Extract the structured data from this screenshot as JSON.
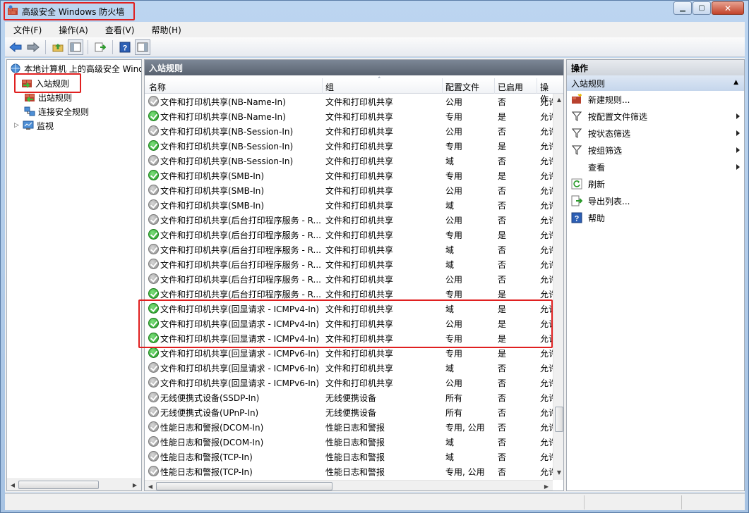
{
  "window": {
    "title": "高级安全 Windows 防火墙",
    "min_label": "▁",
    "max_label": "▢",
    "close_label": "✕"
  },
  "menu": [
    "文件(F)",
    "操作(A)",
    "查看(V)",
    "帮助(H)"
  ],
  "tree": {
    "root": "本地计算机 上的高级安全 Windows 防火墙",
    "items": [
      "入站规则",
      "出站规则",
      "连接安全规则",
      "监视"
    ]
  },
  "list": {
    "title": "入站规则",
    "columns": [
      "名称",
      "组",
      "配置文件",
      "已启用",
      "操作"
    ],
    "rows": [
      {
        "name": "文件和打印机共享(NB-Name-In)",
        "group": "文件和打印机共享",
        "profile": "公用",
        "enabled": "否",
        "action": "允许",
        "on": false
      },
      {
        "name": "文件和打印机共享(NB-Name-In)",
        "group": "文件和打印机共享",
        "profile": "专用",
        "enabled": "是",
        "action": "允许",
        "on": true
      },
      {
        "name": "文件和打印机共享(NB-Session-In)",
        "group": "文件和打印机共享",
        "profile": "公用",
        "enabled": "否",
        "action": "允许",
        "on": false
      },
      {
        "name": "文件和打印机共享(NB-Session-In)",
        "group": "文件和打印机共享",
        "profile": "专用",
        "enabled": "是",
        "action": "允许",
        "on": true
      },
      {
        "name": "文件和打印机共享(NB-Session-In)",
        "group": "文件和打印机共享",
        "profile": "域",
        "enabled": "否",
        "action": "允许",
        "on": false
      },
      {
        "name": "文件和打印机共享(SMB-In)",
        "group": "文件和打印机共享",
        "profile": "专用",
        "enabled": "是",
        "action": "允许",
        "on": true
      },
      {
        "name": "文件和打印机共享(SMB-In)",
        "group": "文件和打印机共享",
        "profile": "公用",
        "enabled": "否",
        "action": "允许",
        "on": false
      },
      {
        "name": "文件和打印机共享(SMB-In)",
        "group": "文件和打印机共享",
        "profile": "域",
        "enabled": "否",
        "action": "允许",
        "on": false
      },
      {
        "name": "文件和打印机共享(后台打印程序服务 - R...",
        "group": "文件和打印机共享",
        "profile": "公用",
        "enabled": "否",
        "action": "允许",
        "on": false
      },
      {
        "name": "文件和打印机共享(后台打印程序服务 - R...",
        "group": "文件和打印机共享",
        "profile": "专用",
        "enabled": "是",
        "action": "允许",
        "on": true
      },
      {
        "name": "文件和打印机共享(后台打印程序服务 - R...",
        "group": "文件和打印机共享",
        "profile": "域",
        "enabled": "否",
        "action": "允许",
        "on": false
      },
      {
        "name": "文件和打印机共享(后台打印程序服务 - R...",
        "group": "文件和打印机共享",
        "profile": "域",
        "enabled": "否",
        "action": "允许",
        "on": false
      },
      {
        "name": "文件和打印机共享(后台打印程序服务 - R...",
        "group": "文件和打印机共享",
        "profile": "公用",
        "enabled": "否",
        "action": "允许",
        "on": false
      },
      {
        "name": "文件和打印机共享(后台打印程序服务 - R...",
        "group": "文件和打印机共享",
        "profile": "专用",
        "enabled": "是",
        "action": "允许",
        "on": true
      },
      {
        "name": "文件和打印机共享(回显请求 - ICMPv4-In)",
        "group": "文件和打印机共享",
        "profile": "域",
        "enabled": "是",
        "action": "允许",
        "on": true
      },
      {
        "name": "文件和打印机共享(回显请求 - ICMPv4-In)",
        "group": "文件和打印机共享",
        "profile": "公用",
        "enabled": "是",
        "action": "允许",
        "on": true
      },
      {
        "name": "文件和打印机共享(回显请求 - ICMPv4-In)",
        "group": "文件和打印机共享",
        "profile": "专用",
        "enabled": "是",
        "action": "允许",
        "on": true
      },
      {
        "name": "文件和打印机共享(回显请求 - ICMPv6-In)",
        "group": "文件和打印机共享",
        "profile": "专用",
        "enabled": "是",
        "action": "允许",
        "on": true
      },
      {
        "name": "文件和打印机共享(回显请求 - ICMPv6-In)",
        "group": "文件和打印机共享",
        "profile": "域",
        "enabled": "否",
        "action": "允许",
        "on": false
      },
      {
        "name": "文件和打印机共享(回显请求 - ICMPv6-In)",
        "group": "文件和打印机共享",
        "profile": "公用",
        "enabled": "否",
        "action": "允许",
        "on": false
      },
      {
        "name": "无线便携式设备(SSDP-In)",
        "group": "无线便携设备",
        "profile": "所有",
        "enabled": "否",
        "action": "允许",
        "on": false
      },
      {
        "name": "无线便携式设备(UPnP-In)",
        "group": "无线便携设备",
        "profile": "所有",
        "enabled": "否",
        "action": "允许",
        "on": false
      },
      {
        "name": "性能日志和警报(DCOM-In)",
        "group": "性能日志和警报",
        "profile": "专用, 公用",
        "enabled": "否",
        "action": "允许",
        "on": false
      },
      {
        "name": "性能日志和警报(DCOM-In)",
        "group": "性能日志和警报",
        "profile": "域",
        "enabled": "否",
        "action": "允许",
        "on": false
      },
      {
        "name": "性能日志和警报(TCP-In)",
        "group": "性能日志和警报",
        "profile": "域",
        "enabled": "否",
        "action": "允许",
        "on": false
      },
      {
        "name": "性能日志和警报(TCP-In)",
        "group": "性能日志和警报",
        "profile": "专用, 公用",
        "enabled": "否",
        "action": "允许",
        "on": false
      }
    ]
  },
  "actions": {
    "title": "操作",
    "section": "入站规则",
    "items": [
      {
        "label": "新建规则...",
        "icon": "new-rule-icon",
        "submenu": false
      },
      {
        "label": "按配置文件筛选",
        "icon": "filter-icon",
        "submenu": true
      },
      {
        "label": "按状态筛选",
        "icon": "filter-icon",
        "submenu": true
      },
      {
        "label": "按组筛选",
        "icon": "filter-icon",
        "submenu": true
      },
      {
        "label": "查看",
        "icon": "",
        "submenu": true
      },
      {
        "label": "刷新",
        "icon": "refresh-icon",
        "submenu": false
      },
      {
        "label": "导出列表...",
        "icon": "export-icon",
        "submenu": false
      },
      {
        "label": "帮助",
        "icon": "help-icon",
        "submenu": false
      }
    ]
  }
}
